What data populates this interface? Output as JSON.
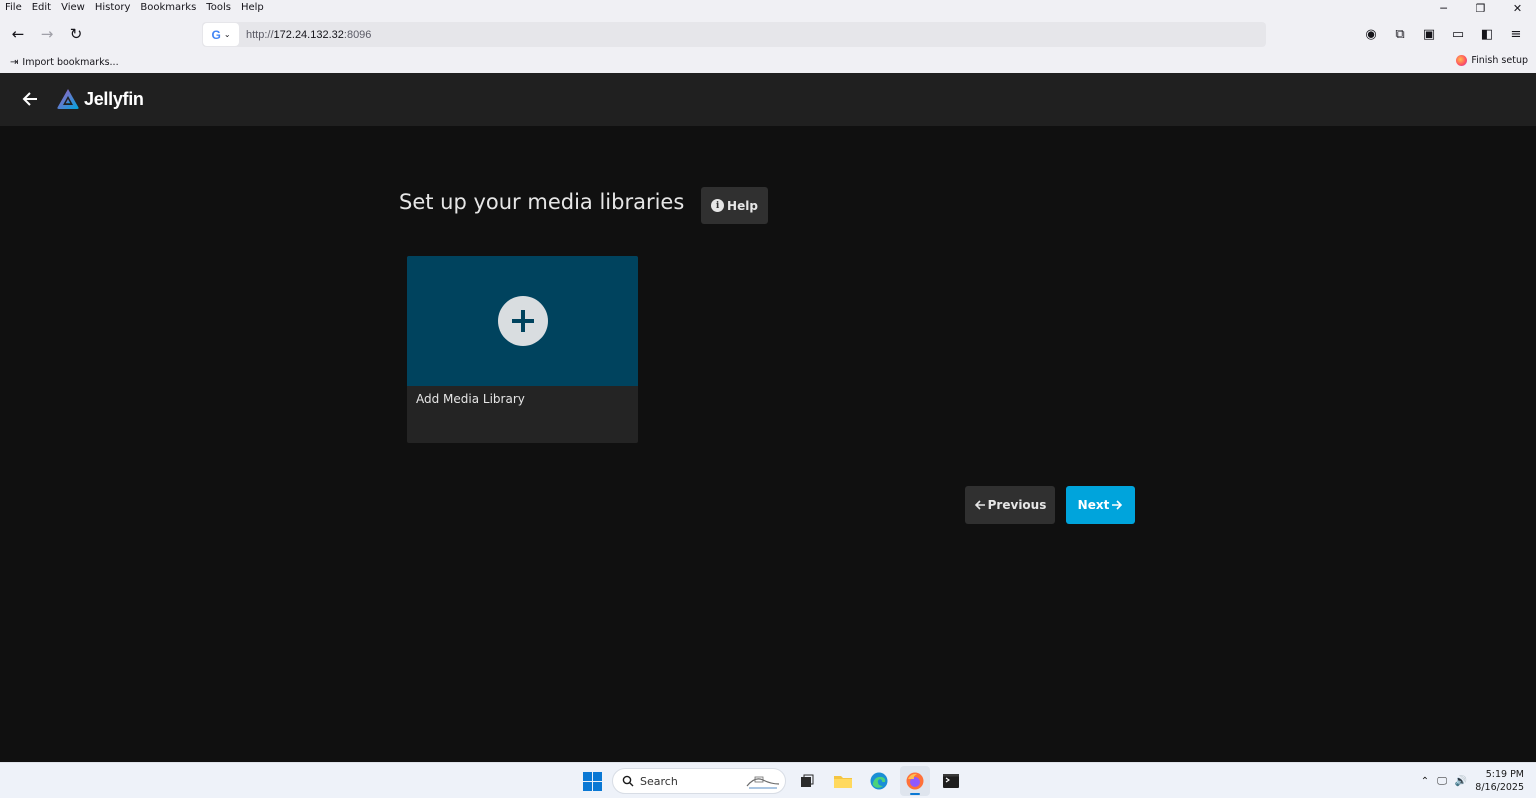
{
  "browser": {
    "menu": [
      "File",
      "Edit",
      "View",
      "History",
      "Bookmarks",
      "Tools",
      "Help"
    ],
    "url_scheme": "http://",
    "url_host": "172.24.132.32",
    "url_port": ":8096",
    "search_engine_icon": "google-icon",
    "bookmark_label": "Import bookmarks...",
    "finish_setup_label": "Finish setup"
  },
  "app": {
    "name": "Jellyfin",
    "page_title": "Set up your media libraries",
    "help_label": "Help",
    "card_label": "Add Media Library",
    "prev_label": "Previous",
    "next_label": "Next",
    "colors": {
      "accent": "#00a4dc",
      "card_thumb": "#00435e",
      "header_bg": "#202020",
      "page_bg": "#101010"
    }
  },
  "taskbar": {
    "search_placeholder": "Search",
    "time": "5:19 PM",
    "date": "8/16/2025"
  }
}
